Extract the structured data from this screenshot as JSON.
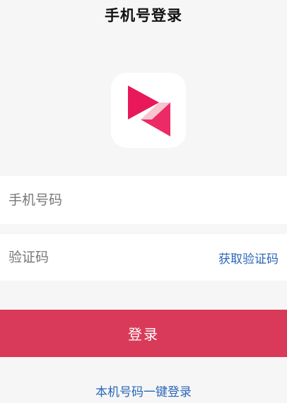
{
  "header": {
    "title": "手机号登录"
  },
  "logo": {
    "icon": "app-logo-icon",
    "colors": {
      "primary": "#e8185b",
      "secondary": "#f4456f",
      "highlight": "#f7c4cf"
    }
  },
  "form": {
    "phone": {
      "placeholder": "手机号码",
      "value": ""
    },
    "code": {
      "placeholder": "验证码",
      "value": "",
      "get_code_label": "获取验证码"
    },
    "login_label": "登录",
    "one_click_label": "本机号码一键登录"
  },
  "colors": {
    "background": "#f6f6f6",
    "login_button": "#d93a59",
    "link": "#2a66b8"
  }
}
